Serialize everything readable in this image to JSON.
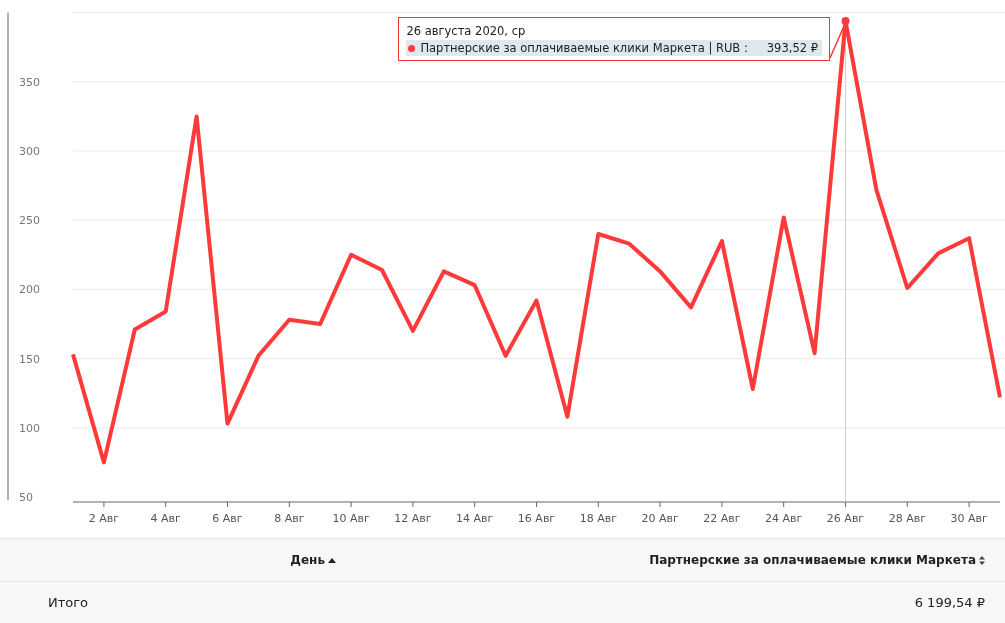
{
  "chart": {
    "chart_data": {
      "type": "line",
      "x": [
        1,
        2,
        3,
        4,
        5,
        6,
        7,
        8,
        9,
        10,
        11,
        12,
        13,
        14,
        15,
        16,
        17,
        18,
        19,
        20,
        21,
        22,
        23,
        24,
        25,
        26,
        27,
        28,
        29,
        30,
        31
      ],
      "series": [
        {
          "name": "Партнерские за оплачиваемые клики Маркета | RUB",
          "color": "#fc3a3a",
          "values": [
            153,
            75,
            171,
            184,
            325,
            103,
            152,
            178,
            175,
            225,
            214,
            170,
            213,
            203,
            152,
            192,
            108,
            240,
            233,
            213,
            187,
            235,
            128,
            252,
            154,
            394,
            272,
            201,
            226,
            237,
            122
          ]
        }
      ],
      "xlim": [
        1,
        31
      ],
      "xticks": [
        {
          "value": 2,
          "label": "2 Авг"
        },
        {
          "value": 4,
          "label": "4 Авг"
        },
        {
          "value": 6,
          "label": "6 Авг"
        },
        {
          "value": 8,
          "label": "8 Авг"
        },
        {
          "value": 10,
          "label": "10 Авг"
        },
        {
          "value": 12,
          "label": "12 Авг"
        },
        {
          "value": 14,
          "label": "14 Авг"
        },
        {
          "value": 16,
          "label": "16 Авг"
        },
        {
          "value": 18,
          "label": "18 Авг"
        },
        {
          "value": 20,
          "label": "20 Авг"
        },
        {
          "value": 22,
          "label": "22 Авг"
        },
        {
          "value": 24,
          "label": "24 Авг"
        },
        {
          "value": 26,
          "label": "26 Авг"
        },
        {
          "value": 28,
          "label": "28 Авг"
        },
        {
          "value": 30,
          "label": "30 Авг"
        }
      ],
      "yticks": [
        50,
        100,
        150,
        200,
        250,
        300,
        350
      ],
      "grid": true,
      "ylim": [
        50,
        400
      ],
      "ref_lines": [
        {
          "axis": "x",
          "value": 26
        }
      ]
    },
    "tooltip": {
      "date": "26 августа 2020, ср",
      "separator": ":",
      "value": "393,52 ₽"
    }
  },
  "table": {
    "columns": [
      {
        "label": "День",
        "sorted": true
      },
      {
        "label": "Партнерские за оплачиваемые клики Маркета",
        "sorted": false
      }
    ],
    "total": {
      "label": "Итого",
      "value": "6 199,54 ₽"
    }
  }
}
